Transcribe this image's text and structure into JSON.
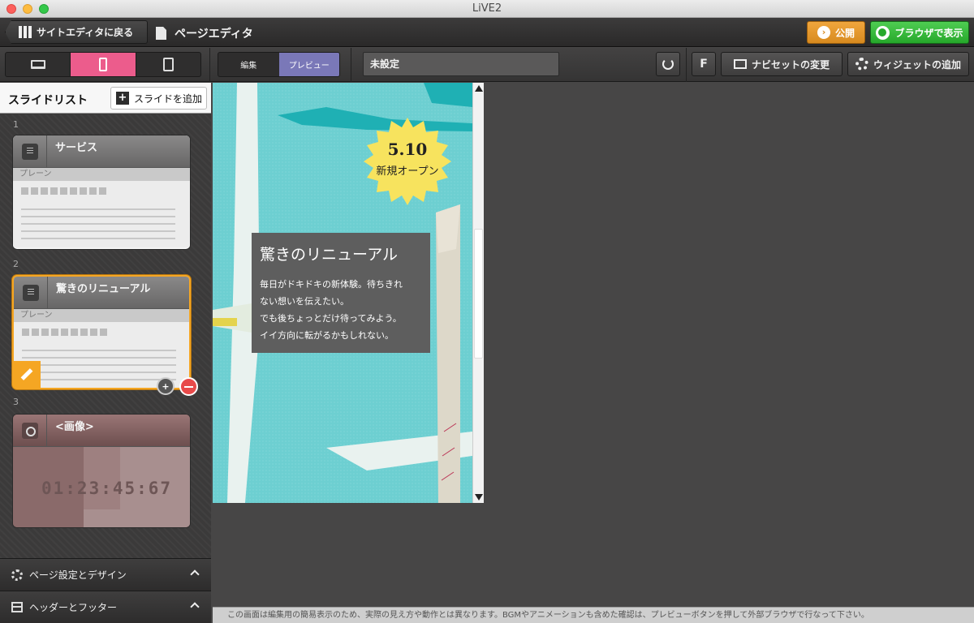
{
  "window": {
    "title": "LiVE2"
  },
  "header": {
    "back_label": "サイトエディタに戻る",
    "page_editor_label": "ページエディタ",
    "publish_label": "公開",
    "browser_label": "ブラウザで表示"
  },
  "toolbar": {
    "edit_label": "編集",
    "preview_label": "プレビュー",
    "page_value": "未設定",
    "f_label": "F",
    "navset_label": "ナビセットの変更",
    "widget_label": "ウィジェットの追加"
  },
  "sidebar": {
    "title": "スライドリスト",
    "add_slide_label": "スライドを追加",
    "slides": [
      {
        "number": "1",
        "title": "サービス",
        "subtitle": "プレーン"
      },
      {
        "number": "2",
        "title": "驚きのリニューアル",
        "subtitle": "プレーン"
      },
      {
        "number": "3",
        "title": "<画像>",
        "timer": "01:23:45:67"
      }
    ],
    "page_settings_label": "ページ設定とデザイン",
    "header_footer_label": "ヘッダーとフッター"
  },
  "preview": {
    "badge_number": "5.10",
    "badge_text": "新規オープン",
    "headline": "驚きのリニューアル",
    "body_lines": [
      "毎日がドキドキの新体験。待ちきれ",
      "ない想いを伝えたい。",
      "でも後ちょっとだけ待ってみよう。",
      "イイ方向に転がるかもしれない。"
    ]
  },
  "status": {
    "note": "この画面は編集用の簡易表示のため、実際の見え方や動作とは異なります。BGMやアニメーションも含めた確認は、プレビューボタンを押して外部ブラウザで行なって下さい。"
  },
  "colors": {
    "accent_pink": "#ec5c8c",
    "publish_orange": "#e6961f",
    "browser_green": "#2fb534",
    "preview_purple": "#7a78b8",
    "selection_orange": "#f5a623"
  }
}
